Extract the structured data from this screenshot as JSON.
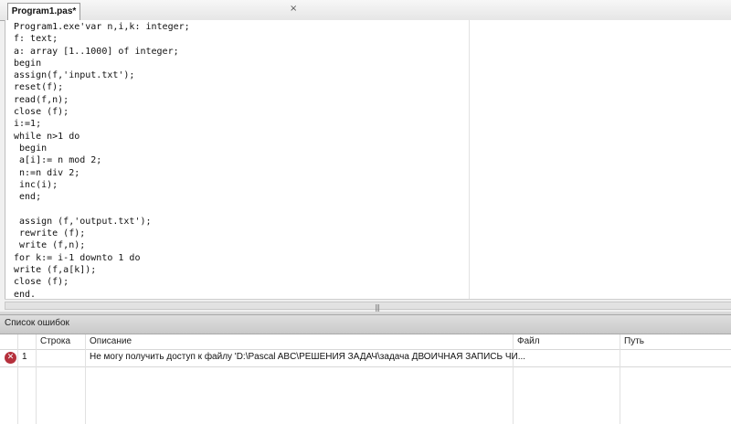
{
  "tab": {
    "title": "Program1.pas*",
    "close_glyph": "×"
  },
  "editor": {
    "lines": [
      "Program1.exe'var n,i,k: integer;",
      "f: text;",
      "a: array [1..1000] of integer;",
      "begin",
      "assign(f,'input.txt');",
      "reset(f);",
      "read(f,n);",
      "close (f);",
      "i:=1;",
      "while n>1 do",
      " begin",
      " a[i]:= n mod 2;",
      " n:=n div 2;",
      " inc(i);",
      " end;",
      "",
      " assign (f,'output.txt');",
      " rewrite (f);",
      " write (f,n);",
      "for k:= i-1 downto 1 do",
      "write (f,a[k]);",
      "close (f);",
      "end."
    ]
  },
  "error_panel": {
    "title": "Список ошибок",
    "columns": [
      "Строка",
      "Описание",
      "Файл",
      "Путь"
    ],
    "rows": [
      {
        "icon": "error-icon",
        "index": "1",
        "line": "",
        "description": "Не могу получить доступ к файлу 'D:\\Pascal ABC\\РЕШЕНИЯ ЗАДАЧ\\задача ДВОИЧНАЯ ЗАПИСЬ ЧИ...",
        "file": "",
        "path": ""
      }
    ]
  },
  "colors": {
    "error_icon": "#b5303c",
    "editor_bg": "#ffffff",
    "panel_header": "#d4d4d4"
  }
}
